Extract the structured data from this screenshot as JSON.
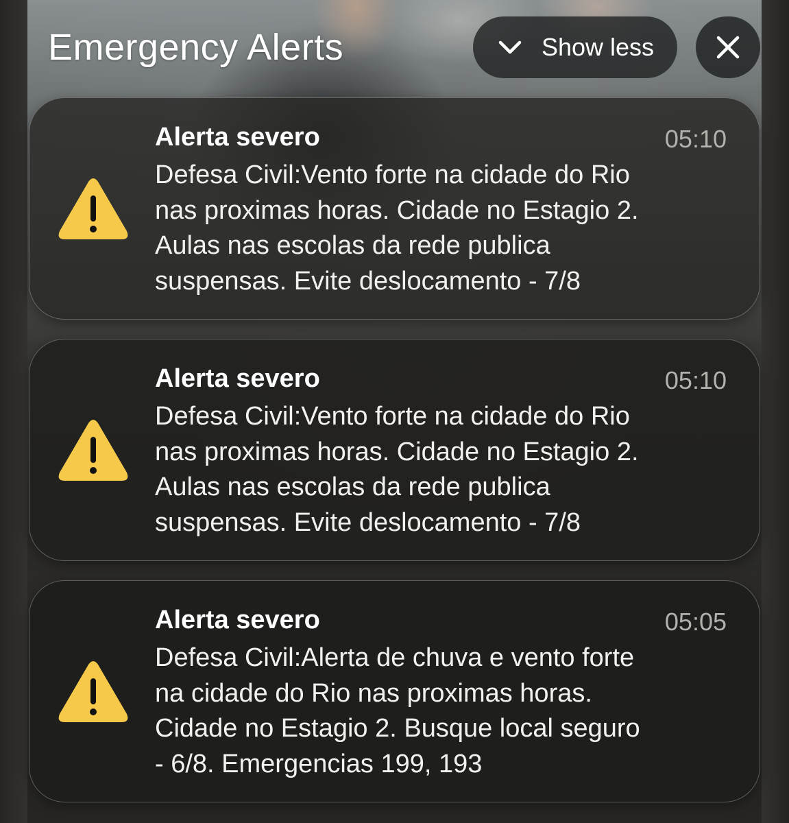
{
  "header": {
    "title": "Emergency Alerts",
    "show_less_label": "Show less",
    "show_less_icon": "chevron-down-icon",
    "close_icon": "close-icon"
  },
  "colors": {
    "warning_yellow": "#f6c94a",
    "card_background": "#222220",
    "time_gray": "#b3b1ac"
  },
  "alerts": [
    {
      "title": "Alerta severo",
      "time": "05:10",
      "icon": "warning-triangle-icon",
      "body": "Defesa Civil:Vento forte na cidade do Rio\nnas proximas horas. Cidade no Estagio 2.\nAulas nas escolas da rede publica\nsuspensas. Evite deslocamento - 7/8"
    },
    {
      "title": "Alerta severo",
      "time": "05:10",
      "icon": "warning-triangle-icon",
      "body": "Defesa Civil:Vento forte na cidade do Rio\nnas proximas horas. Cidade no Estagio 2.\nAulas nas escolas da rede publica\nsuspensas. Evite deslocamento - 7/8"
    },
    {
      "title": "Alerta severo",
      "time": "05:05",
      "icon": "warning-triangle-icon",
      "body": "Defesa Civil:Alerta de chuva e vento forte\nna cidade do Rio nas proximas horas.\nCidade no Estagio 2. Busque local seguro\n- 6/8. Emergencias 199, 193"
    }
  ]
}
